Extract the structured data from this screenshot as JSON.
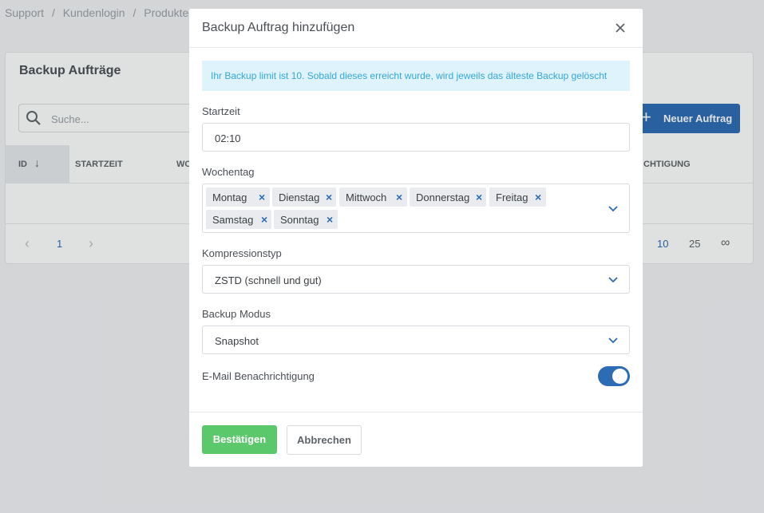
{
  "breadcrumb": [
    "Support",
    "/",
    "Kundenlogin",
    "/",
    "Produkte & D"
  ],
  "page": {
    "card_title": "Backup Aufträge",
    "search_placeholder": "Suche...",
    "new_button": "Neuer Auftrag",
    "columns": {
      "id": "ID",
      "id_sort": "↓",
      "startzeit": "STARTZEIT",
      "wo": "WO",
      "benachrichtigung": "CHTIGUNG"
    },
    "pager": {
      "prev": "‹",
      "page": "1",
      "next": "›",
      "sizes": [
        "10",
        "25",
        "∞"
      ]
    }
  },
  "modal": {
    "title": "Backup Auftrag hinzufügen",
    "info": "Ihr Backup limit ist 10. Sobald dieses erreicht wurde, wird jeweils das älteste Backup gelöscht",
    "startzeit_label": "Startzeit",
    "startzeit_value": "02:10",
    "wochentag_label": "Wochentag",
    "days": [
      "Montag",
      "Dienstag",
      "Mittwoch",
      "Donnerstag",
      "Freitag",
      "Samstag",
      "Sonntag"
    ],
    "tag_remove": "×",
    "kompression_label": "Kompressionstyp",
    "kompression_value": "ZSTD (schnell und gut)",
    "modus_label": "Backup Modus",
    "modus_value": "Snapshot",
    "email_label": "E-Mail Benachrichtigung",
    "email_enabled": true,
    "confirm": "Bestätigen",
    "cancel": "Abbrechen"
  },
  "colors": {
    "primary": "#2c6cb5",
    "success": "#5cc86c",
    "info_bg": "#def3fb",
    "info_text": "#35a7dc"
  }
}
